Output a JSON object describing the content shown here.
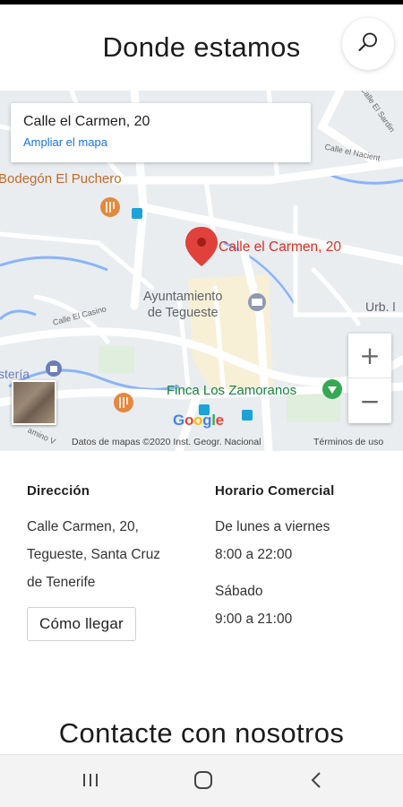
{
  "header": {
    "title": "Donde estamos",
    "search_icon": "search-icon"
  },
  "map": {
    "card_title": "Calle el Carmen, 20",
    "card_link": "Ampliar el mapa",
    "pin_label": "Calle el Carmen, 20",
    "labels": {
      "bodegon": "Bodegón El Puchero",
      "ayuntamiento_line1": "Ayuntamiento",
      "ayuntamiento_line2": "de Tegueste",
      "finca": "Finca Los Zamoranos",
      "urb": "Urb. l",
      "calle_casino": "Calle El Casino",
      "calle_nacient": "Calle el Nacient",
      "calle_sardin": "Calle El Sardin",
      "teria": "stería",
      "camino": "amino V"
    },
    "zoom_in": "+",
    "zoom_out": "−",
    "google_logo": "Google",
    "attribution": "Datos de mapas ©2020 Inst. Geogr. Nacional",
    "terms": "Términos de uso",
    "colors": {
      "pin": "#d93025",
      "orange_poi": "#e3893e",
      "green_poi": "#34a853",
      "link": "#1a73e8"
    }
  },
  "address": {
    "heading": "Dirección",
    "lines": [
      "Calle Carmen, 20,",
      "Tegueste, Santa Cruz",
      "de Tenerife"
    ],
    "directions_button": "Cómo llegar"
  },
  "hours": {
    "heading": "Horario Comercial",
    "weekday_label": "De lunes a viernes",
    "weekday_hours": "8:00 a 22:00",
    "saturday_label": "Sábado",
    "saturday_hours": "9:00 a 21:00"
  },
  "contact": {
    "title": "Contacte con nosotros"
  },
  "navbar": {
    "recents_icon": "recent-apps-icon",
    "home_icon": "home-icon",
    "back_icon": "back-icon"
  }
}
